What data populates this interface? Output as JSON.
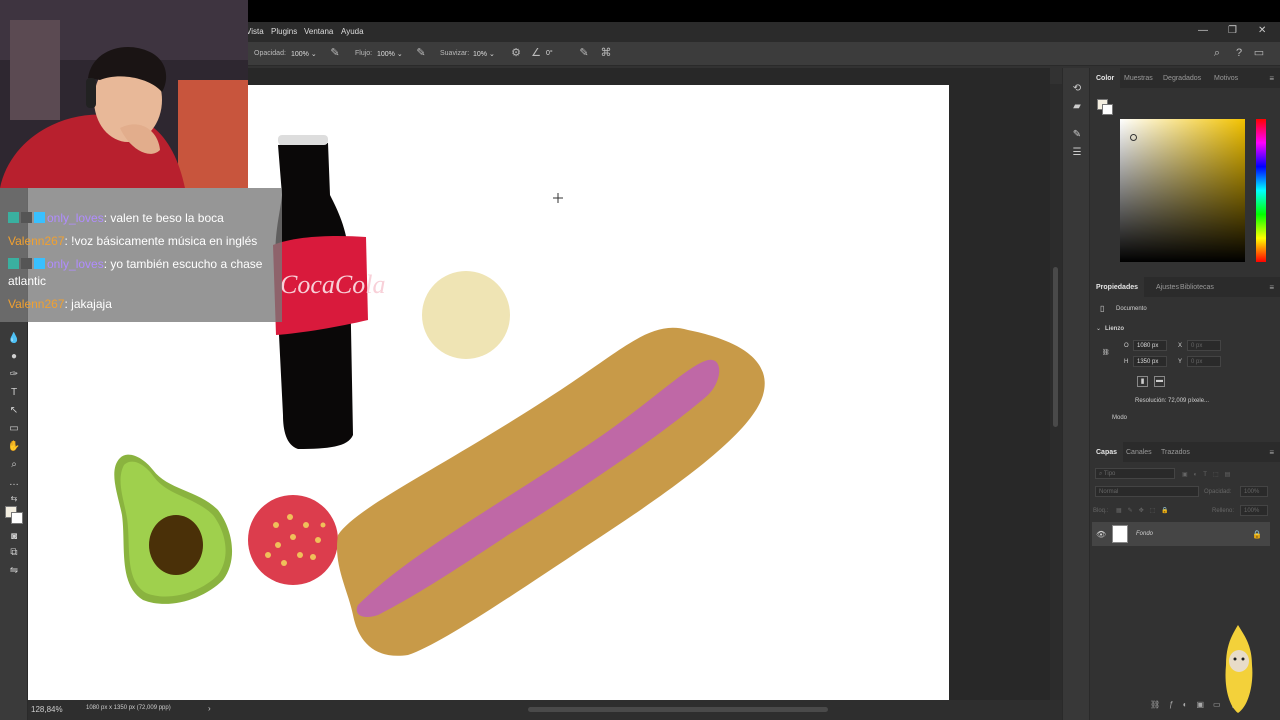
{
  "menubar": {
    "items": [
      "Vista",
      "Plugins",
      "Ventana",
      "Ayuda"
    ]
  },
  "window_controls": {
    "minimize": "—",
    "restore": "❐",
    "close": "✕"
  },
  "options_bar": {
    "opacity_label": "Opacidad:",
    "opacity_value": "100%",
    "flow_label": "Flujo:",
    "flow_value": "100%",
    "smoothing_label": "Suavizar:",
    "smoothing_value": "10%",
    "angle_value": "0°"
  },
  "status_bar": {
    "zoom": "128,84%",
    "doc_info": "1080 px x 1350 px (72,009 ppp)",
    "arrow": "›"
  },
  "color_panel": {
    "tabs": [
      "Color",
      "Muestras",
      "Degradados",
      "Motivos"
    ],
    "active_tab": "Color",
    "hue_color": "#f2c200"
  },
  "properties_panel": {
    "tabs": [
      "Propiedades",
      "Ajustes",
      "Bibliotecas"
    ],
    "doc_label": "Documento",
    "section": "Lienzo",
    "width_label": "O",
    "width_value": "1080 px",
    "x_label": "X",
    "x_value": "0 px",
    "height_label": "H",
    "height_value": "1350 px",
    "y_label": "Y",
    "y_value": "0 px",
    "resolution": "Resolución: 72,009 píxele...",
    "mode_label": "Modo"
  },
  "layers_panel": {
    "tabs": [
      "Capas",
      "Canales",
      "Trazados"
    ],
    "search_placeholder": "Tipo",
    "blend_mode": "Normal",
    "opacity_label": "Opacidad:",
    "opacity_value": "100%",
    "lock_label": "Bloq.:",
    "fill_label": "Relleno:",
    "fill_value": "100%",
    "layers": [
      {
        "name": "Fondo",
        "visible": true,
        "locked": true
      }
    ]
  },
  "chat": {
    "messages": [
      {
        "user": "only_loves",
        "text": "valen te beso la boca",
        "color": "purple",
        "badges": true
      },
      {
        "user": "Valenn267",
        "text": "!voz básicamente música en inglés",
        "color": "orange",
        "badges": false
      },
      {
        "user": "only_loves",
        "text": "yo también escucho a chase",
        "text2": "atlantic",
        "color": "purple",
        "badges": true
      },
      {
        "user": "Valenn267",
        "text": "jakajaja",
        "color": "orange",
        "badges": false
      }
    ]
  },
  "canvas_drawing": {
    "bottle_label": "CocaCola"
  }
}
